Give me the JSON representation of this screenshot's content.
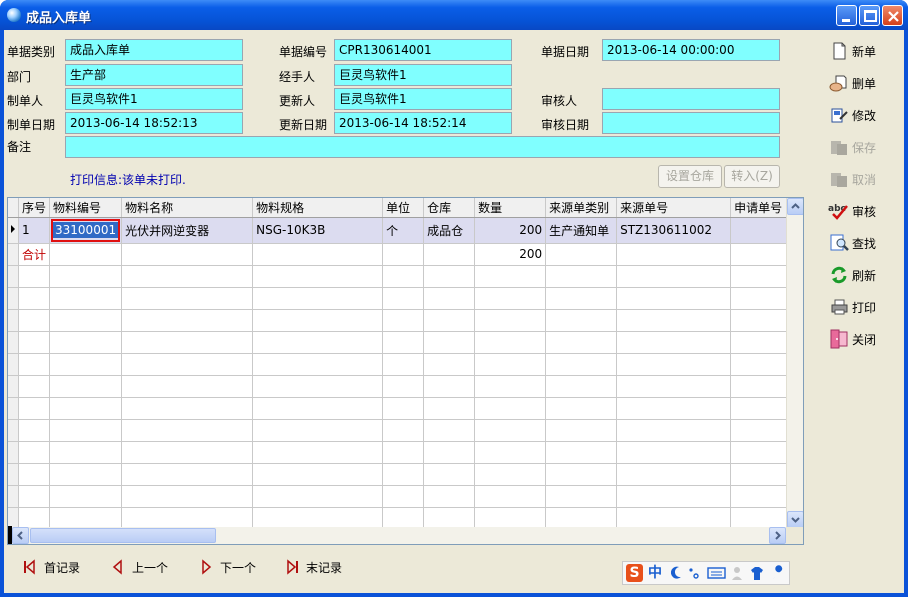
{
  "window": {
    "title": "成品入库单"
  },
  "form": {
    "doc_type": {
      "label": "单据类别",
      "value": "成品入库单"
    },
    "doc_no": {
      "label": "单据编号",
      "value": "CPR130614001"
    },
    "doc_date": {
      "label": "单据日期",
      "value": "2013-06-14 00:00:00"
    },
    "dept": {
      "label": "部门",
      "value": "生产部"
    },
    "handler": {
      "label": "经手人",
      "value": "巨灵鸟软件1"
    },
    "creator": {
      "label": "制单人",
      "value": "巨灵鸟软件1"
    },
    "updater": {
      "label": "更新人",
      "value": "巨灵鸟软件1"
    },
    "auditor": {
      "label": "审核人",
      "value": ""
    },
    "create_date": {
      "label": "制单日期",
      "value": "2013-06-14 18:52:13"
    },
    "update_date": {
      "label": "更新日期",
      "value": "2013-06-14 18:52:14"
    },
    "audit_date": {
      "label": "审核日期",
      "value": ""
    },
    "remark": {
      "label": "备注",
      "value": ""
    }
  },
  "print_info": "打印信息:该单未打印.",
  "buttons": {
    "set_warehouse": "设置仓库",
    "transfer_in": "转入(Z)"
  },
  "grid": {
    "columns": [
      "序号",
      "物料编号",
      "物料名称",
      "物料规格",
      "单位",
      "仓库",
      "数量",
      "来源单类别",
      "来源单号",
      "申请单号"
    ],
    "rows": [
      {
        "seq": "1",
        "code": "33100001",
        "name": "光伏并网逆变器",
        "spec": "NSG-10K3B",
        "unit": "个",
        "warehouse": "成品仓",
        "qty": "200",
        "src_type": "生产通知单",
        "src_no": "STZ130611002",
        "req_no": ""
      }
    ],
    "total": {
      "label": "合计",
      "qty": "200"
    }
  },
  "side_actions": [
    {
      "label": "新单",
      "icon": "new-document-icon",
      "enabled": true
    },
    {
      "label": "删单",
      "icon": "delete-document-icon",
      "enabled": true
    },
    {
      "label": "修改",
      "icon": "edit-icon",
      "enabled": true
    },
    {
      "label": "保存",
      "icon": "save-icon",
      "enabled": false
    },
    {
      "label": "取消",
      "icon": "cancel-icon",
      "enabled": false
    },
    {
      "label": "审核",
      "icon": "audit-check-icon",
      "enabled": true
    },
    {
      "label": "查找",
      "icon": "find-icon",
      "enabled": true
    },
    {
      "label": "刷新",
      "icon": "refresh-icon",
      "enabled": true
    },
    {
      "label": "打印",
      "icon": "printer-icon",
      "enabled": true
    },
    {
      "label": "关闭",
      "icon": "close-door-icon",
      "enabled": true
    }
  ],
  "nav": {
    "first": "首记录",
    "prev": "上一个",
    "next": "下一个",
    "last": "末记录"
  },
  "ime": {
    "logo": "S",
    "mode": "中"
  }
}
